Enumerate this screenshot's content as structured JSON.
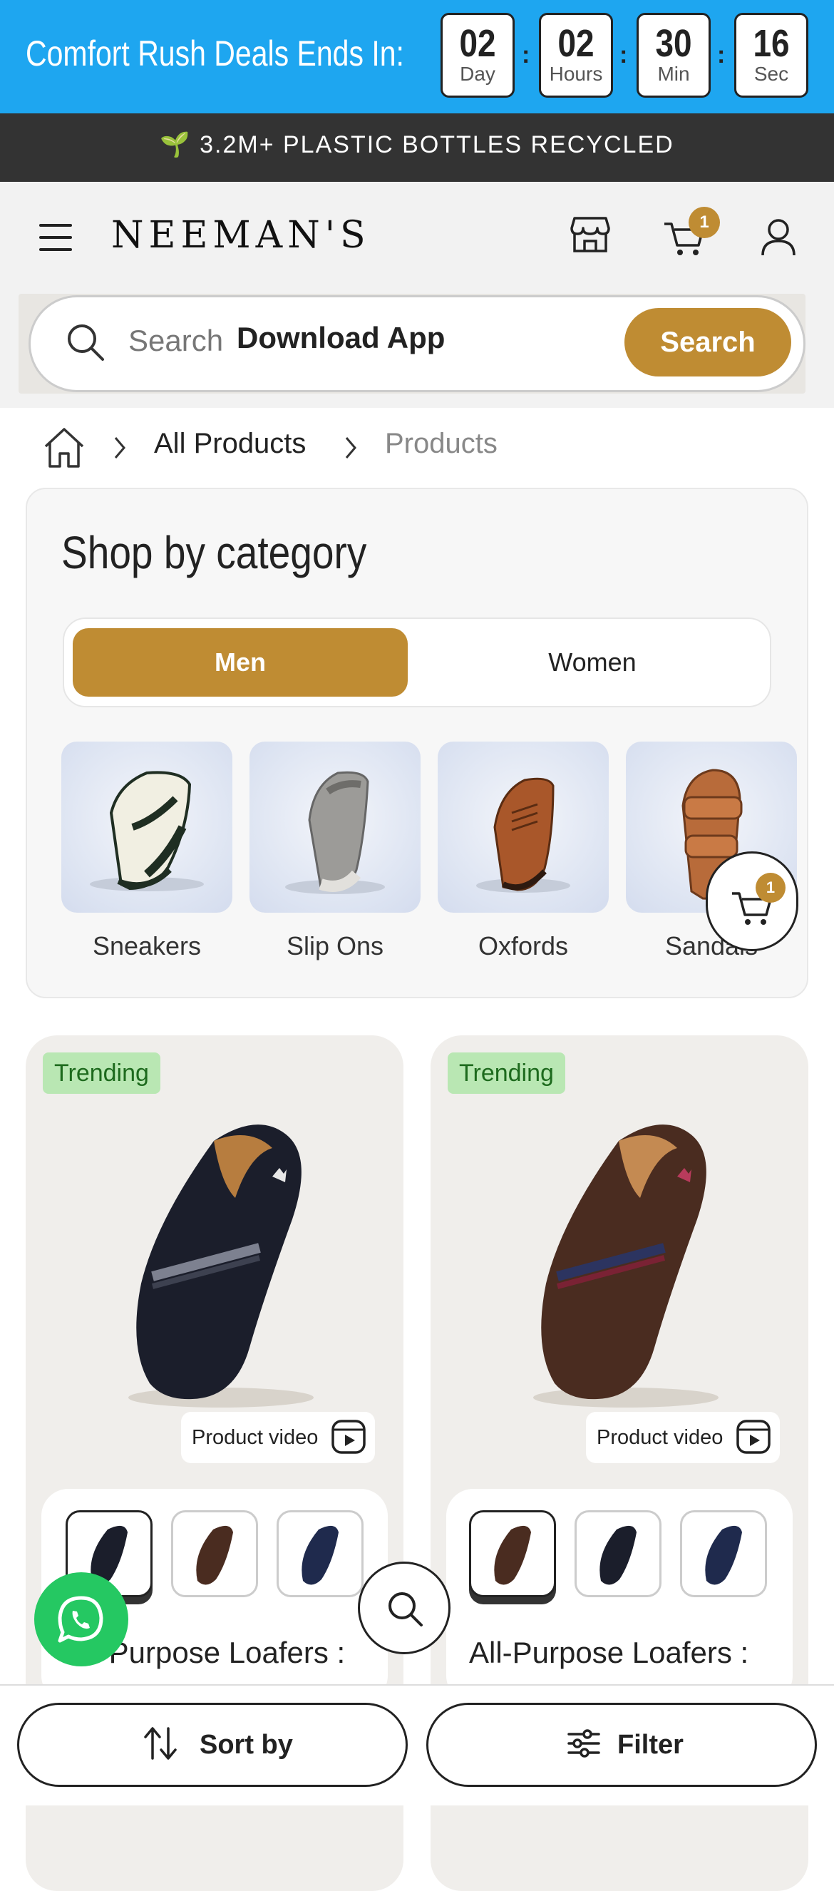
{
  "deal_banner": {
    "title": "Comfort Rush Deals Ends In:",
    "timer": [
      {
        "value": "02",
        "label": "Day"
      },
      {
        "value": "02",
        "label": "Hours"
      },
      {
        "value": "30",
        "label": "Min"
      },
      {
        "value": "16",
        "label": "Sec"
      }
    ],
    "separator": ":",
    "background_color": "#1ea6f0"
  },
  "recycle_banner": {
    "emoji": "🌱",
    "text": "3.2M+ PLASTIC BOTTLES RECYCLED"
  },
  "header": {
    "brand": "NEEMAN'S",
    "cart_count": "1",
    "icons": [
      "menu-icon",
      "store-icon",
      "cart-icon",
      "user-icon"
    ]
  },
  "search": {
    "placeholder": "Search",
    "rotating_text": "Download App",
    "button_label": "Search"
  },
  "breadcrumb": {
    "items": [
      "All Products",
      "Products"
    ]
  },
  "category": {
    "title": "Shop by category",
    "tabs": [
      {
        "label": "Men",
        "selected": true
      },
      {
        "label": "Women",
        "selected": false
      }
    ],
    "items": [
      {
        "label": "Sneakers"
      },
      {
        "label": "Slip Ons"
      },
      {
        "label": "Oxfords"
      },
      {
        "label": "Sandals"
      }
    ],
    "accent_color": "#bf8c33"
  },
  "floating_cart": {
    "count": "1"
  },
  "products": [
    {
      "badge": "Trending",
      "video_label": "Product video",
      "title": "All-Purpose Loafers :",
      "color": "#1b1e2b"
    },
    {
      "badge": "Trending",
      "video_label": "Product video",
      "title": "All-Purpose Loafers :",
      "color": "#4a2c20"
    }
  ],
  "bottom_bar": {
    "sort_label": "Sort by",
    "filter_label": "Filter"
  }
}
